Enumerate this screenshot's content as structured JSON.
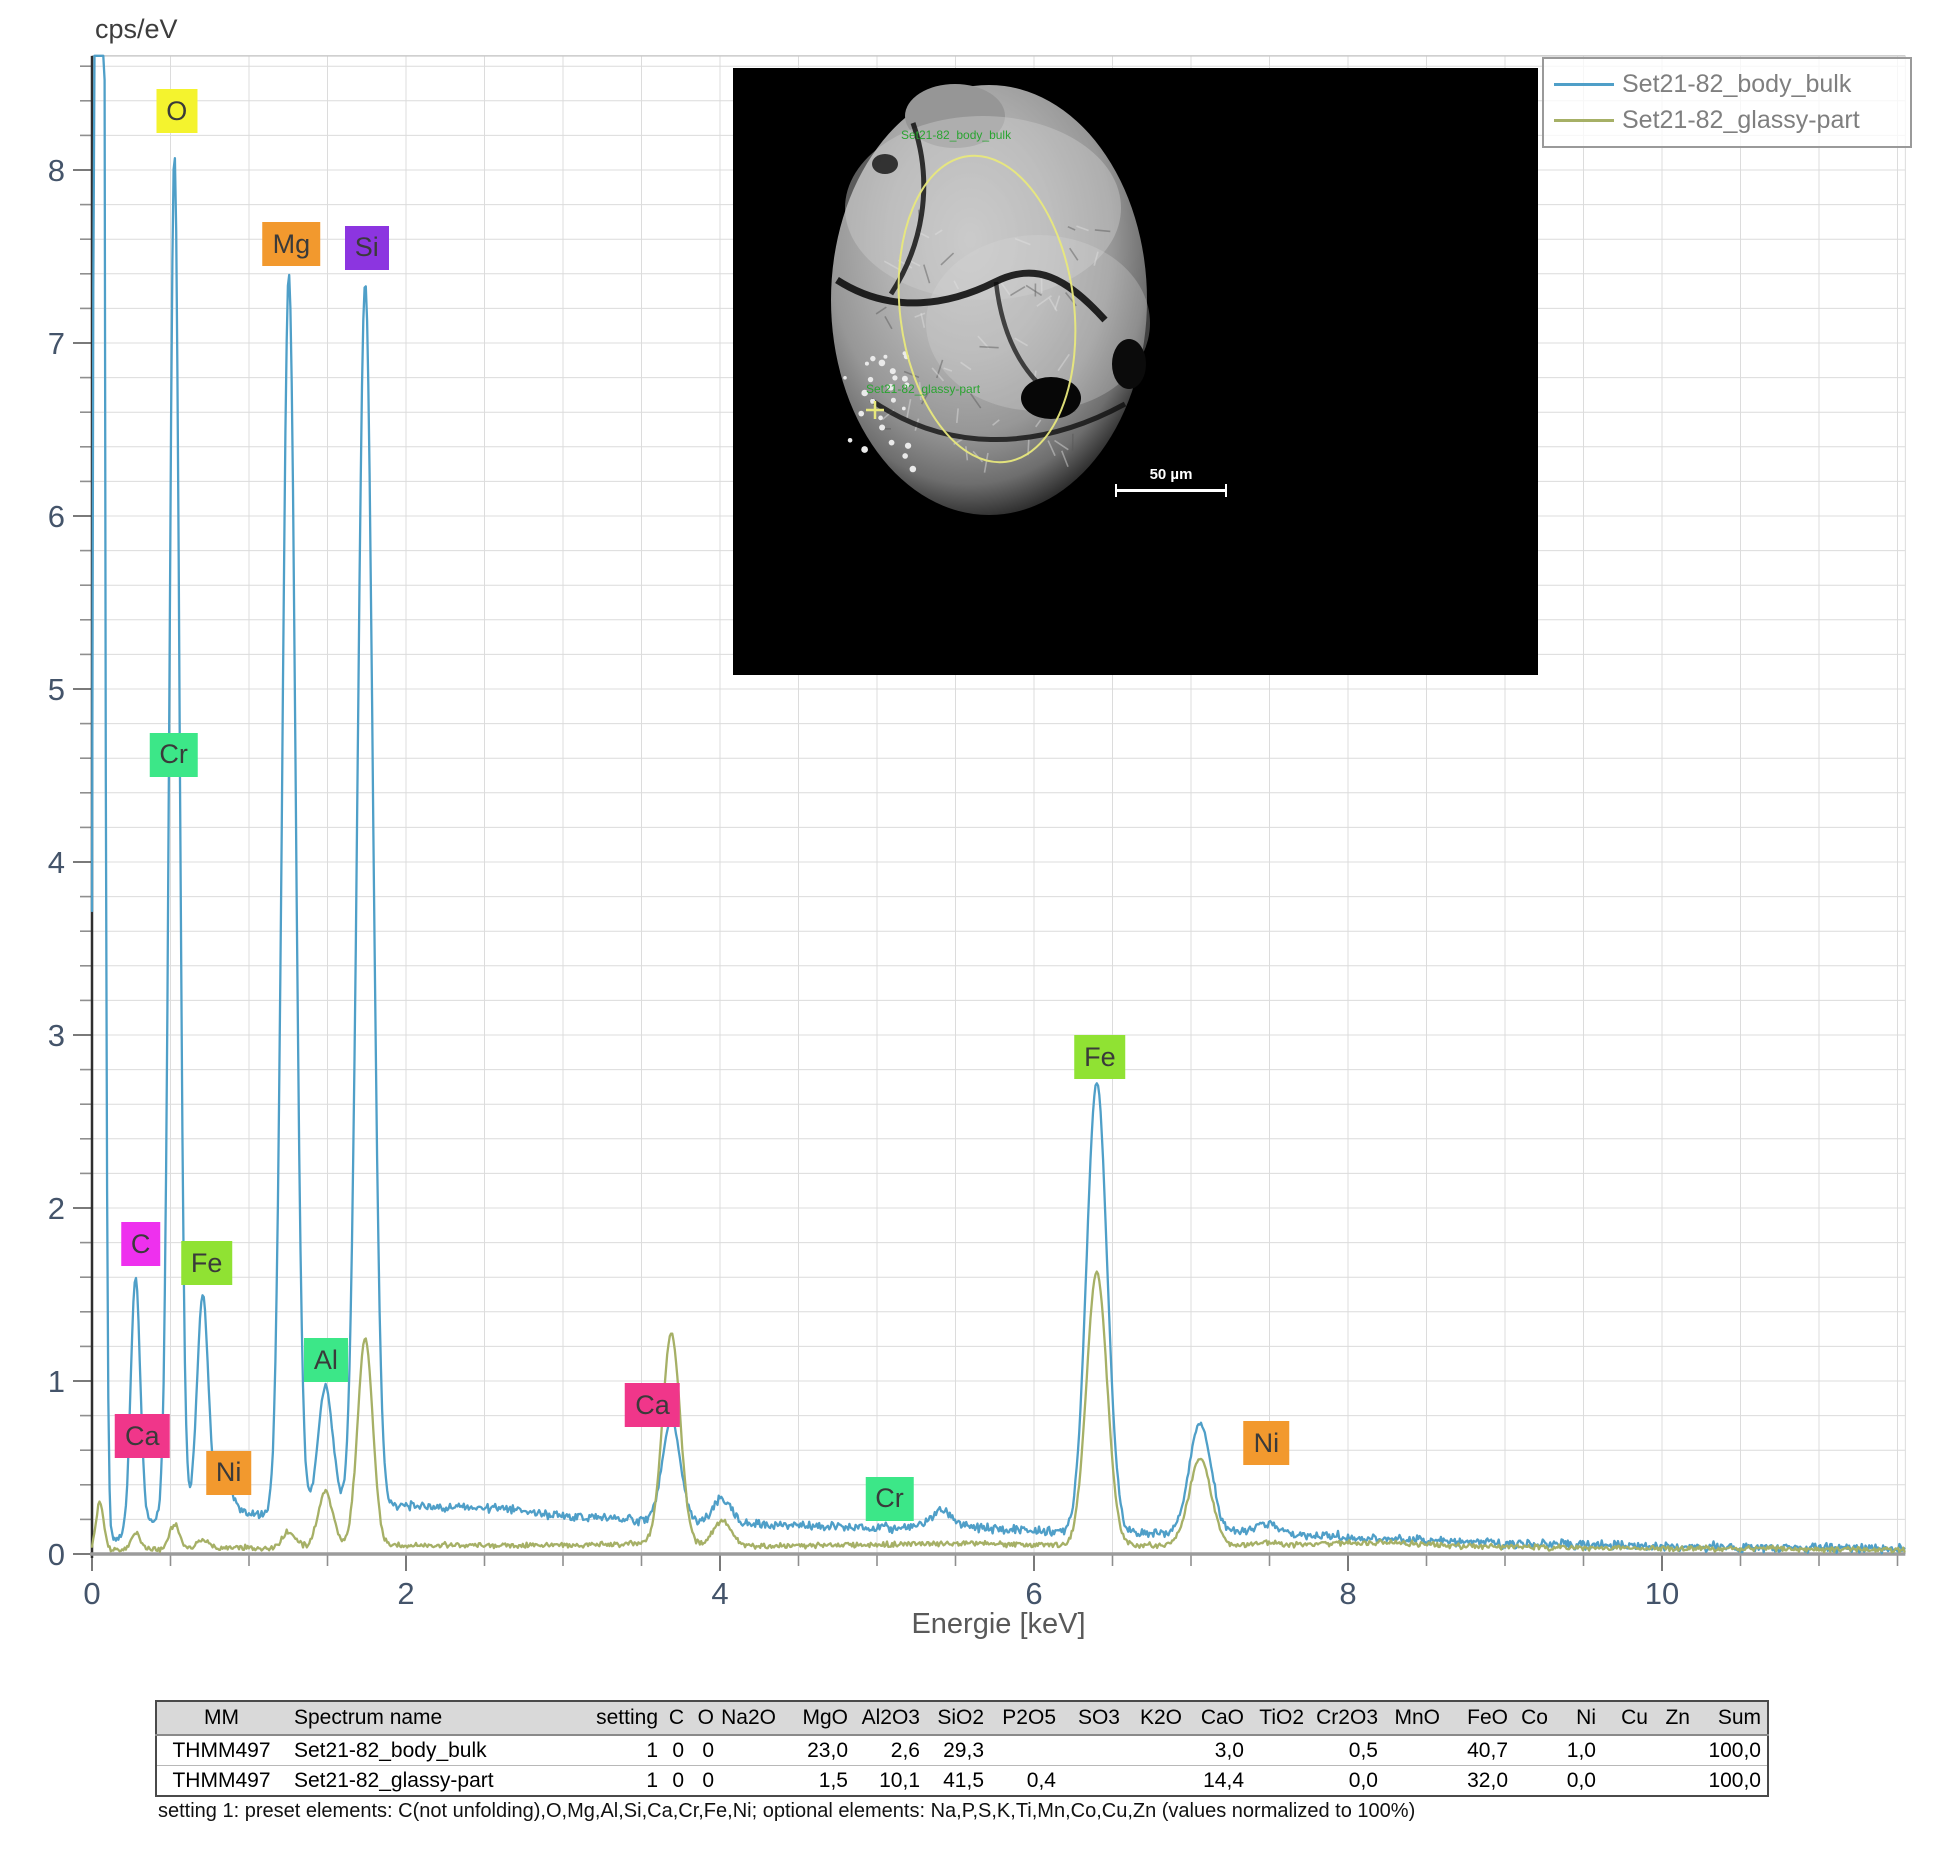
{
  "chart_data": {
    "type": "line",
    "title": "",
    "xlabel": "Energie [keV]",
    "ylabel": "cps/eV",
    "xlim": [
      0,
      11.55
    ],
    "ylim": [
      0,
      8.66
    ],
    "xtick_labels": [
      0,
      2,
      4,
      6,
      8,
      10
    ],
    "x_minor_step": 0.5,
    "ytick_labels": [
      0,
      1,
      2,
      3,
      4,
      5,
      6,
      7,
      8
    ],
    "y_minor_step": 0.2,
    "grid": true,
    "legend_position": "top-right",
    "series": [
      {
        "name": "Set21-82_body_bulk",
        "color": "#4f9fc8",
        "noise": 0.02,
        "baseline": [
          [
            0,
            0.02
          ],
          [
            0.2,
            0.1
          ],
          [
            0.45,
            0.22
          ],
          [
            0.9,
            0.24
          ],
          [
            1.1,
            0.22
          ],
          [
            1.6,
            0.26
          ],
          [
            2.0,
            0.28
          ],
          [
            2.6,
            0.26
          ],
          [
            3.0,
            0.22
          ],
          [
            3.6,
            0.19
          ],
          [
            4.2,
            0.17
          ],
          [
            5.0,
            0.15
          ],
          [
            5.6,
            0.15
          ],
          [
            6.1,
            0.13
          ],
          [
            6.8,
            0.12
          ],
          [
            7.4,
            0.12
          ],
          [
            8.0,
            0.1
          ],
          [
            8.4,
            0.08
          ],
          [
            9.0,
            0.06
          ],
          [
            10.0,
            0.045
          ],
          [
            11.0,
            0.035
          ],
          [
            11.55,
            0.03
          ]
        ],
        "peaks": [
          [
            0.045,
            30,
            0.022
          ],
          [
            0.277,
            1.46,
            0.03
          ],
          [
            0.525,
            7.88,
            0.032
          ],
          [
            0.705,
            1.27,
            0.036
          ],
          [
            0.851,
            0.22,
            0.042
          ],
          [
            1.254,
            7.17,
            0.042
          ],
          [
            1.487,
            0.72,
            0.046
          ],
          [
            1.74,
            7.08,
            0.048
          ],
          [
            3.69,
            0.59,
            0.056
          ],
          [
            4.013,
            0.14,
            0.056
          ],
          [
            5.41,
            0.1,
            0.07
          ],
          [
            6.4,
            2.6,
            0.065
          ],
          [
            7.058,
            0.64,
            0.07
          ],
          [
            7.48,
            0.06,
            0.072
          ]
        ]
      },
      {
        "name": "Set21-82_glassy-part",
        "color": "#a6b066",
        "noise": 0.012,
        "baseline": [
          [
            0,
            0.015
          ],
          [
            0.5,
            0.03
          ],
          [
            1.0,
            0.035
          ],
          [
            2.0,
            0.05
          ],
          [
            3.0,
            0.05
          ],
          [
            3.6,
            0.06
          ],
          [
            4.3,
            0.045
          ],
          [
            5.0,
            0.055
          ],
          [
            5.6,
            0.06
          ],
          [
            6.2,
            0.05
          ],
          [
            7.0,
            0.05
          ],
          [
            7.6,
            0.05
          ],
          [
            8.2,
            0.07
          ],
          [
            8.6,
            0.05
          ],
          [
            9.5,
            0.035
          ],
          [
            10.5,
            0.03
          ],
          [
            11.55,
            0.025
          ]
        ],
        "peaks": [
          [
            0.05,
            0.28,
            0.025
          ],
          [
            0.277,
            0.1,
            0.03
          ],
          [
            0.525,
            0.14,
            0.032
          ],
          [
            0.705,
            0.05,
            0.036
          ],
          [
            1.254,
            0.09,
            0.042
          ],
          [
            1.487,
            0.32,
            0.046
          ],
          [
            1.74,
            1.2,
            0.048
          ],
          [
            3.69,
            1.22,
            0.056
          ],
          [
            4.013,
            0.14,
            0.056
          ],
          [
            6.4,
            1.58,
            0.065
          ],
          [
            7.058,
            0.5,
            0.07
          ],
          [
            7.48,
            0.02,
            0.072
          ]
        ]
      }
    ],
    "element_labels": [
      {
        "el": "O",
        "color": "#f4f32e",
        "x": 0.54,
        "y": 8.34
      },
      {
        "el": "Mg",
        "color": "#f2992e",
        "x": 1.27,
        "y": 7.57
      },
      {
        "el": "Si",
        "color": "#8c35e0",
        "x": 1.75,
        "y": 7.55
      },
      {
        "el": "Cr",
        "color": "#3ce788",
        "x": 0.52,
        "y": 4.62
      },
      {
        "el": "C",
        "color": "#ee30ee",
        "x": 0.31,
        "y": 1.79
      },
      {
        "el": "Fe",
        "color": "#90e233",
        "x": 0.73,
        "y": 1.68
      },
      {
        "el": "Al",
        "color": "#3ce788",
        "x": 1.49,
        "y": 1.12
      },
      {
        "el": "Ca",
        "color": "#f0368a",
        "x": 0.32,
        "y": 0.68
      },
      {
        "el": "Ni",
        "color": "#f2992e",
        "x": 0.87,
        "y": 0.47
      },
      {
        "el": "Ca",
        "color": "#f0368a",
        "x": 3.57,
        "y": 0.86
      },
      {
        "el": "Cr",
        "color": "#3ce788",
        "x": 5.08,
        "y": 0.32
      },
      {
        "el": "Fe",
        "color": "#90e233",
        "x": 6.42,
        "y": 2.87
      },
      {
        "el": "Ni",
        "color": "#f2992e",
        "x": 7.48,
        "y": 0.64
      }
    ]
  },
  "sem": {
    "bulk_label": "Set21-82_body_bulk",
    "glassy_label": "Set21-82_glassy-part",
    "scale_label": "50 µm",
    "annotation_color": "#2aa431",
    "marker_color": "#e8e87c"
  },
  "table": {
    "headers": [
      "MM",
      "Spectrum name",
      "setting",
      "C",
      "O",
      "Na2O",
      "MgO",
      "Al2O3",
      "SiO2",
      "P2O5",
      "SO3",
      "K2O",
      "CaO",
      "TiO2",
      "Cr2O3",
      "MnO",
      "FeO",
      "Co",
      "Ni",
      "Cu",
      "Zn",
      "Sum"
    ],
    "rows": [
      [
        "THMM497",
        "Set21-82_body_bulk",
        "1",
        "0",
        "0",
        "",
        "23,0",
        "2,6",
        "29,3",
        "",
        "",
        "",
        "3,0",
        "",
        "0,5",
        "",
        "40,7",
        "",
        "1,0",
        "",
        "",
        "100,0"
      ],
      [
        "THMM497",
        "Set21-82_glassy-part",
        "1",
        "0",
        "0",
        "",
        "1,5",
        "10,1",
        "41,5",
        "0,4",
        "",
        "",
        "14,4",
        "",
        "0,0",
        "",
        "32,0",
        "",
        "0,0",
        "",
        "",
        "100,0"
      ]
    ]
  },
  "footnote": "setting 1: preset elements: C(not unfolding),O,Mg,Al,Si,Ca,Cr,Fe,Ni; optional elements: Na,P,S,K,Ti,Mn,Co,Cu,Zn (values normalized to 100%)"
}
